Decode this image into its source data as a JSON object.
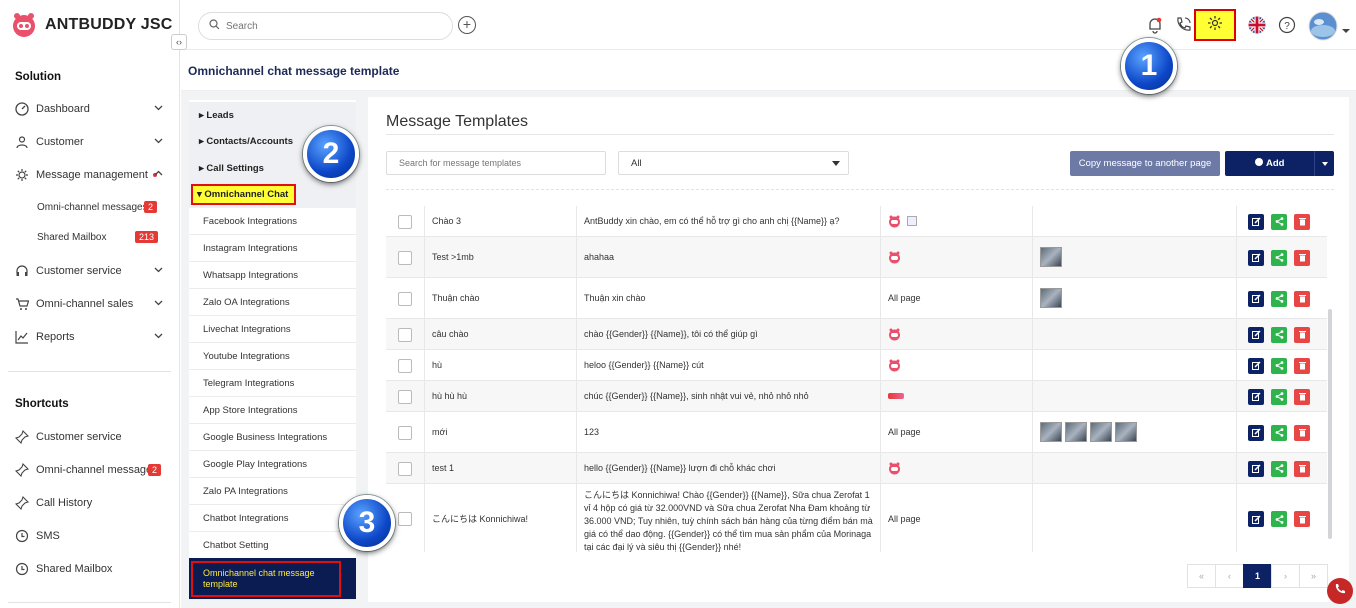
{
  "brand": {
    "name": "ANTBUDDY JSC"
  },
  "topbar": {
    "search_placeholder": "Search"
  },
  "page": {
    "title": "Omnichannel chat message template"
  },
  "sidebar": {
    "solution_title": "Solution",
    "items": [
      {
        "label": "Dashboard"
      },
      {
        "label": "Customer"
      },
      {
        "label": "Message management"
      },
      {
        "label": "Customer service"
      },
      {
        "label": "Omni-channel sales"
      },
      {
        "label": "Reports"
      }
    ],
    "sub_items": [
      {
        "label": "Omni-channel messages",
        "count": "2"
      },
      {
        "label": "Shared Mailbox",
        "count": "213"
      }
    ],
    "shortcuts_title": "Shortcuts",
    "shortcuts": [
      {
        "label": "Customer service"
      },
      {
        "label": "Omni-channel messages",
        "count": "2"
      },
      {
        "label": "Call History"
      },
      {
        "label": "SMS"
      },
      {
        "label": "Shared Mailbox"
      }
    ]
  },
  "settings_menu": {
    "groups": [
      "Leads",
      "Contacts/Accounts",
      "Call Settings",
      "Omnichannel Chat"
    ],
    "items": [
      "Facebook Integrations",
      "Instagram Integrations",
      "Whatsapp Integrations",
      "Zalo OA Integrations",
      "Livechat Integrations",
      "Youtube Integrations",
      "Telegram Integrations",
      "App Store Integrations",
      "Google Business Integrations",
      "Google Play Integrations",
      "Zalo PA Integrations",
      "Chatbot Integrations",
      "Chatbot Setting"
    ],
    "active_item": "Omnichannel chat message template"
  },
  "templates": {
    "heading": "Message Templates",
    "search_placeholder": "Search for message templates",
    "filter_value": "All",
    "copy_button": "Copy message to another page",
    "add_button": "Add",
    "rows": [
      {
        "name": "Chào 3",
        "content": "AntBuddy xin chào, em có thể hỗ trợ gì cho anh chị {{Name}} ạ?",
        "page": "",
        "images": 0
      },
      {
        "name": "Test >1mb",
        "content": "ahahaa",
        "page": "",
        "images": 1
      },
      {
        "name": "Thuận chào",
        "content": "Thuận xin chào",
        "page": "All page",
        "images": 1
      },
      {
        "name": "câu chào",
        "content": "chào {{Gender}} {{Name}}, tôi có thể giúp gì",
        "page": "",
        "images": 0
      },
      {
        "name": "hù",
        "content": "heloo {{Gender}} {{Name}} cút",
        "page": "",
        "images": 0
      },
      {
        "name": "hù hù hù",
        "content": "chúc {{Gender}} {{Name}}, sinh nhật vui vẻ, nhỏ nhỏ nhỏ",
        "page": "",
        "images": 0
      },
      {
        "name": "mới",
        "content": "123",
        "page": "All page",
        "images": 4
      },
      {
        "name": "test 1",
        "content": "hello {{Gender}} {{Name}} lượn đi chỗ khác chơi",
        "page": "",
        "images": 0
      },
      {
        "name": "こんにちは Konnichiwa!",
        "content": "こんにちは Konnichiwa!   Chào {{Gender}} {{Name}}, Sữa chua Zerofat 1 vỉ 4 hộp có giá từ 32.000VND và Sữa chua Zerofat Nha Đam khoảng từ 36.000 VND; Tuy nhiên, tuỳ chính sách bán hàng của từng điểm bán mà giá có thể dao động. {{Gender}} có thể tìm mua sản phẩm của Morinaga tại các đại lý và siêu thị {{Gender}} nhé!",
        "page": "All page",
        "images": 0
      }
    ],
    "pagination": {
      "first": "«",
      "prev": "‹",
      "current": "1",
      "next": "›",
      "last": "»"
    }
  },
  "annotations": [
    "1",
    "2",
    "3"
  ],
  "colors": {
    "navy": "#0d2265",
    "highlight": "#ffff33",
    "red": "#e01010"
  }
}
